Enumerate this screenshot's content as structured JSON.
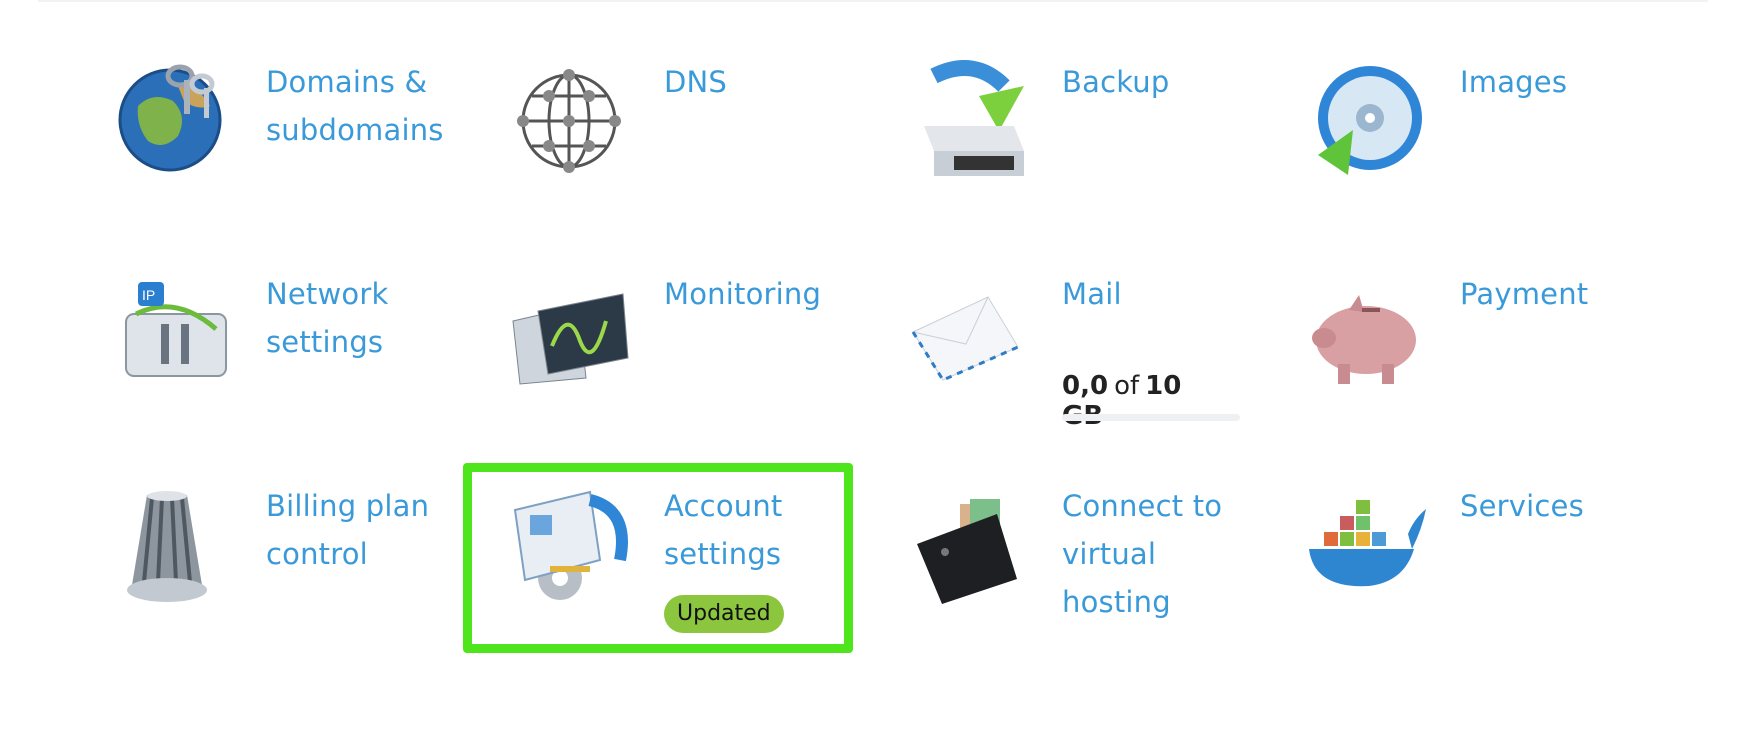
{
  "tiles": [
    {
      "label": "Domains & subdomains",
      "icon": "globe-keys-icon"
    },
    {
      "label": "DNS",
      "icon": "network-sphere-icon"
    },
    {
      "label": "Backup",
      "icon": "backup-server-icon"
    },
    {
      "label": "Images",
      "icon": "disc-image-icon"
    },
    {
      "label": "Network settings",
      "icon": "ip-switch-icon"
    },
    {
      "label": "Monitoring",
      "icon": "oscilloscope-icon"
    },
    {
      "label": "Mail",
      "icon": "envelope-icon"
    },
    {
      "label": "Payment",
      "icon": "piggy-bank-icon"
    },
    {
      "label": "Billing plan control",
      "icon": "knob-icon"
    },
    {
      "label": "Account settings",
      "icon": "account-card-gear-icon"
    },
    {
      "label": "Connect to virtual hosting",
      "icon": "wallet-icon"
    },
    {
      "label": "Services",
      "icon": "docker-whale-icon"
    }
  ],
  "mail_quota": {
    "used": "0,0",
    "of": "of",
    "total": "10 GB",
    "fill_fraction": 0.0
  },
  "account_badge": "Updated",
  "colors": {
    "link": "#3a9ad9",
    "highlight": "#4ee51c",
    "badge": "#8cc63f"
  }
}
